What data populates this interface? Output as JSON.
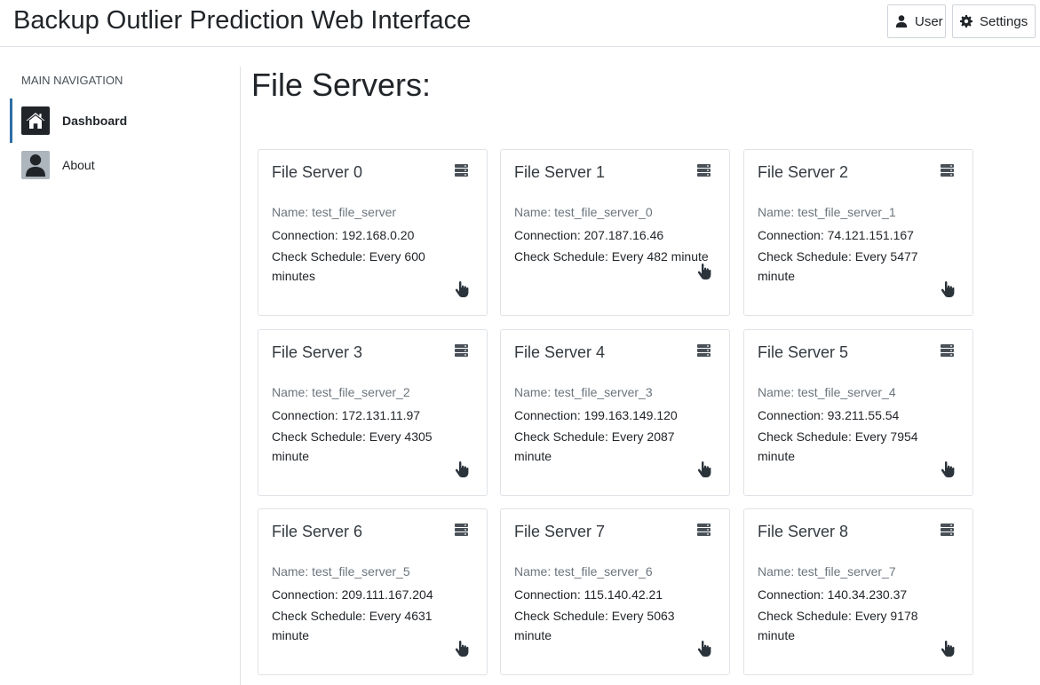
{
  "app": {
    "title": "Backup Outlier Prediction Web Interface"
  },
  "header": {
    "user_label": "User",
    "settings_label": "Settings"
  },
  "sidebar": {
    "heading": "MAIN NAVIGATION",
    "items": [
      {
        "label": "Dashboard",
        "icon": "home-icon",
        "active": true
      },
      {
        "label": "About",
        "icon": "user-icon",
        "active": false
      }
    ]
  },
  "main": {
    "title": "File Servers:",
    "cards": [
      {
        "title": "File Server 0",
        "name": "Name: test_file_server",
        "connection": "Connection: 192.168.0.20",
        "schedule": "Check Schedule: Every 600 minutes"
      },
      {
        "title": "File Server 1",
        "name": "Name: test_file_server_0",
        "connection": "Connection: 207.187.16.46",
        "schedule": "Check Schedule: Every 482 minute"
      },
      {
        "title": "File Server 2",
        "name": "Name: test_file_server_1",
        "connection": "Connection: 74.121.151.167",
        "schedule": "Check Schedule: Every 5477 minute"
      },
      {
        "title": "File Server 3",
        "name": "Name: test_file_server_2",
        "connection": "Connection: 172.131.11.97",
        "schedule": "Check Schedule: Every 4305 minute"
      },
      {
        "title": "File Server 4",
        "name": "Name: test_file_server_3",
        "connection": "Connection: 199.163.149.120",
        "schedule": "Check Schedule: Every 2087 minute"
      },
      {
        "title": "File Server 5",
        "name": "Name: test_file_server_4",
        "connection": "Connection: 93.211.55.54",
        "schedule": "Check Schedule: Every 7954 minute"
      },
      {
        "title": "File Server 6",
        "name": "Name: test_file_server_5",
        "connection": "Connection: 209.111.167.204",
        "schedule": "Check Schedule: Every 4631 minute"
      },
      {
        "title": "File Server 7",
        "name": "Name: test_file_server_6",
        "connection": "Connection: 115.140.42.21",
        "schedule": "Check Schedule: Every 5063 minute"
      },
      {
        "title": "File Server 8",
        "name": "Name: test_file_server_7",
        "connection": "Connection: 140.34.230.37",
        "schedule": "Check Schedule: Every 9178 minute"
      }
    ]
  },
  "colors": {
    "active_accent": "#2e6da4",
    "text": "#212529",
    "muted": "#6c757d",
    "border": "#dfe3e7"
  }
}
